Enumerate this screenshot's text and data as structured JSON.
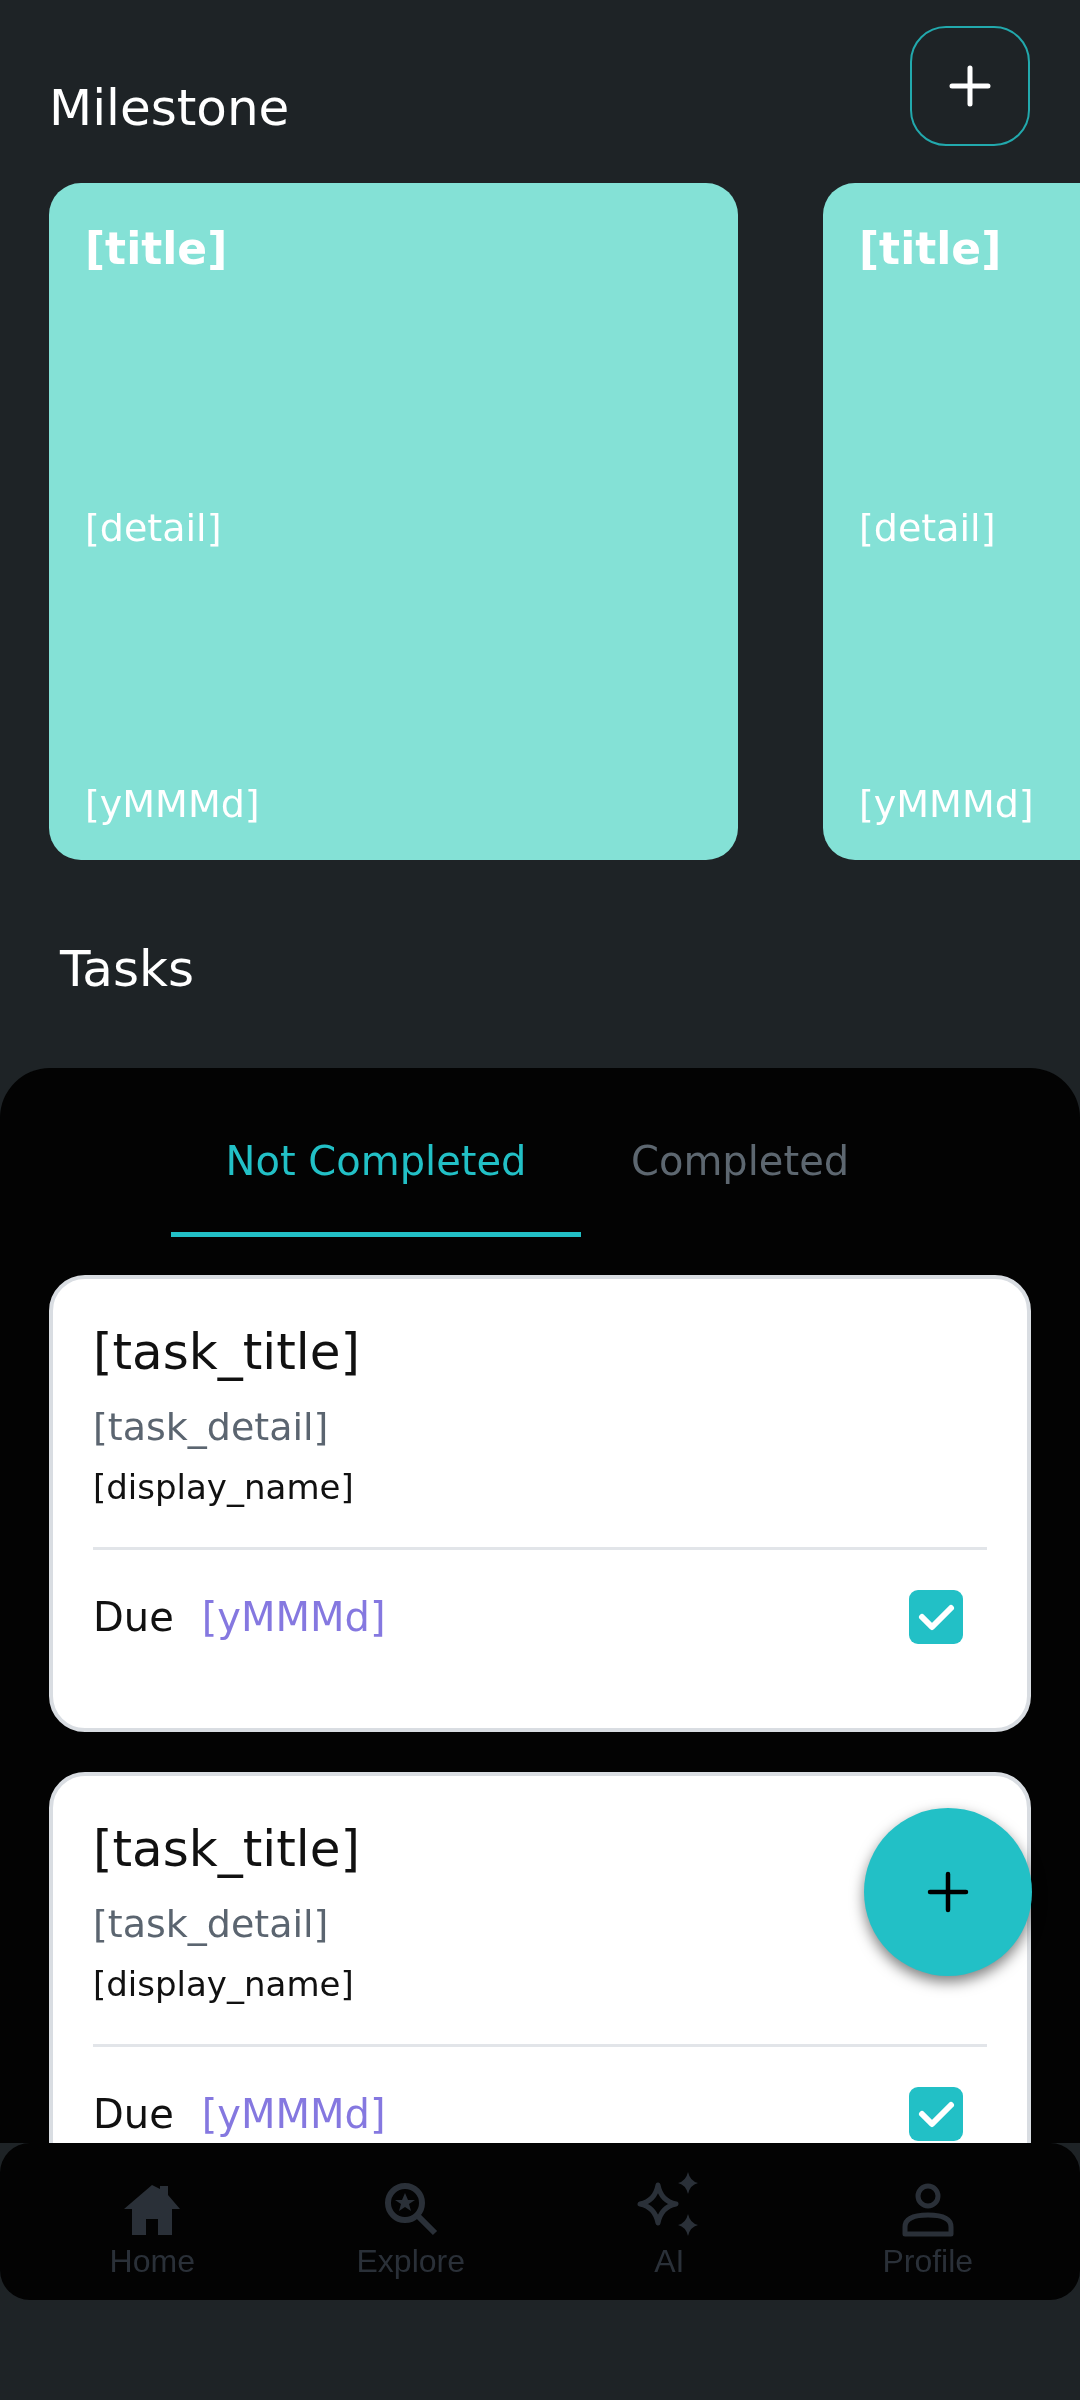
{
  "header": {
    "title": "Milestone"
  },
  "milestones": [
    {
      "title": "[title]",
      "detail": "[detail]",
      "date": "[yMMMd]"
    },
    {
      "title": "[title]",
      "detail": "[detail]",
      "date": "[yMMMd]"
    }
  ],
  "tasks_heading": "Tasks",
  "tabs": [
    {
      "label": "Not Completed",
      "selected": true
    },
    {
      "label": "Completed",
      "selected": false
    }
  ],
  "tasks": [
    {
      "title": "[task_title]",
      "detail": "[task_detail]",
      "display_name": "[display_name]",
      "due_label": "Due",
      "due_date": "[yMMMd]",
      "checked": true
    },
    {
      "title": "[task_title]",
      "detail": "[task_detail]",
      "display_name": "[display_name]",
      "due_label": "Due",
      "due_date": "[yMMMd]",
      "checked": true
    }
  ],
  "nav": [
    {
      "kind": "home",
      "label": "Home"
    },
    {
      "kind": "explore",
      "label": "Explore"
    },
    {
      "kind": "ai",
      "label": "AI"
    },
    {
      "kind": "profile",
      "label": "Profile"
    }
  ]
}
